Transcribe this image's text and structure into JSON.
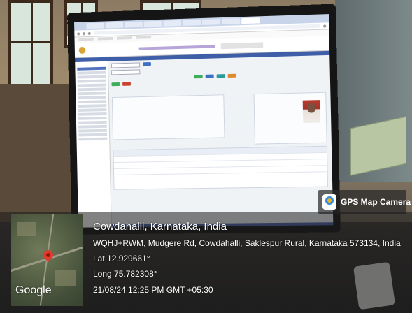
{
  "gps_camera": {
    "badge_label": "GPS Map Camera",
    "icon": "gps-map-camera-icon"
  },
  "location": {
    "title": "Cowdahalli, Karnataka, India",
    "address": "WQHJ+RWM, Mudgere Rd, Cowdahalli, Saklespur Rural, Karnataka 573134, India",
    "lat": "Lat 12.929661°",
    "long": "Long 75.782308°",
    "timestamp": "21/08/24 12:25 PM GMT +05:30"
  },
  "map": {
    "attribution": "Google",
    "pin_icon": "map-pin-icon"
  },
  "colors": {
    "overlay": "#1c1c1c",
    "app_header_bar": "#3f5ea8",
    "pin": "#e23b2e"
  }
}
